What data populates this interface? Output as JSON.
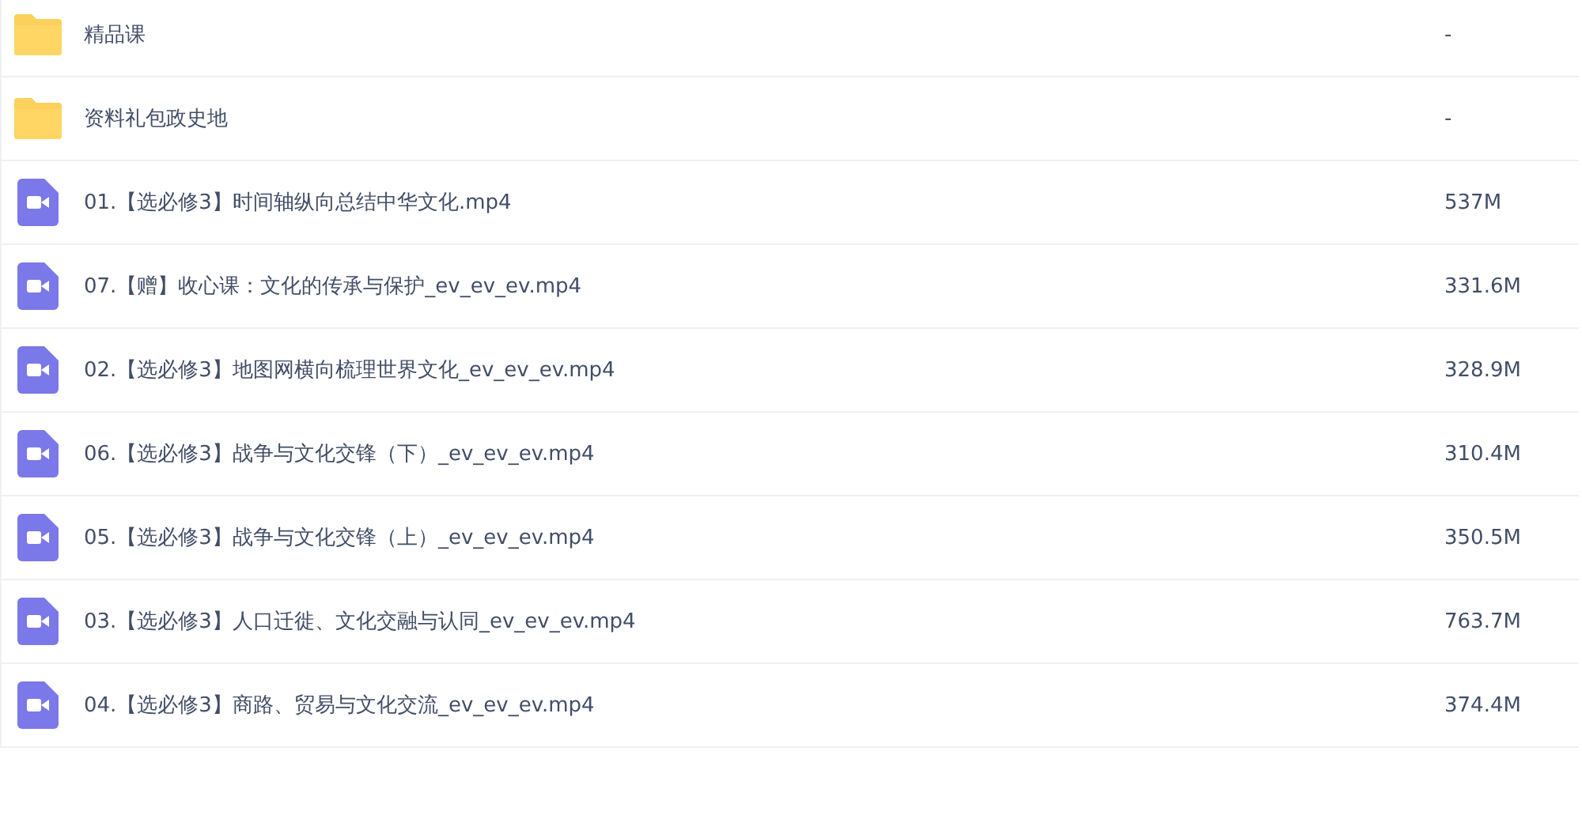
{
  "files": [
    {
      "kind": "folder",
      "name": "精品课",
      "size": "-"
    },
    {
      "kind": "folder",
      "name": "资料礼包政史地",
      "size": "-"
    },
    {
      "kind": "video",
      "name": "01.【选必修3】时间轴纵向总结中华文化.mp4",
      "size": "537M"
    },
    {
      "kind": "video",
      "name": "07.【赠】收心课：文化的传承与保护_ev_ev_ev.mp4",
      "size": "331.6M"
    },
    {
      "kind": "video",
      "name": "02.【选必修3】地图网横向梳理世界文化_ev_ev_ev.mp4",
      "size": "328.9M"
    },
    {
      "kind": "video",
      "name": "06.【选必修3】战争与文化交锋（下）_ev_ev_ev.mp4",
      "size": "310.4M"
    },
    {
      "kind": "video",
      "name": "05.【选必修3】战争与文化交锋（上）_ev_ev_ev.mp4",
      "size": "350.5M"
    },
    {
      "kind": "video",
      "name": "03.【选必修3】人口迁徙、文化交融与认同_ev_ev_ev.mp4",
      "size": "763.7M"
    },
    {
      "kind": "video",
      "name": "04.【选必修3】商路、贸易与文化交流_ev_ev_ev.mp4",
      "size": "374.4M"
    }
  ]
}
